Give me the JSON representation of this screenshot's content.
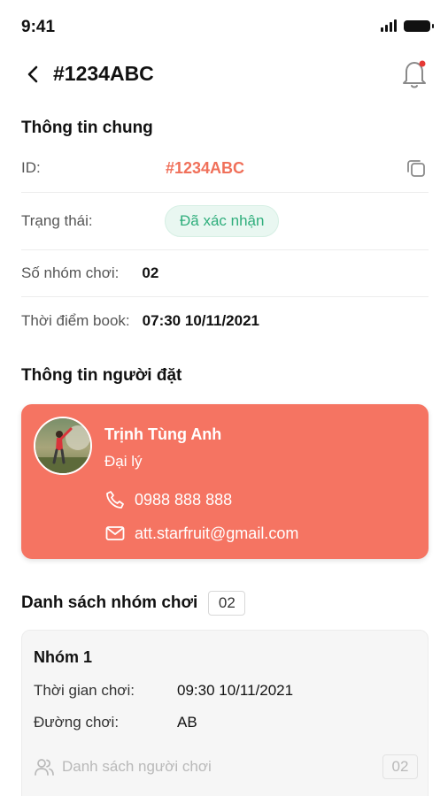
{
  "status_bar": {
    "time": "9:41"
  },
  "header": {
    "title": "#1234ABC",
    "back_icon": "chevron-left-icon",
    "bell_icon": "bell-icon"
  },
  "general": {
    "title": "Thông tin chung",
    "id_label": "ID:",
    "id_value": "#1234ABC",
    "status_label": "Trạng thái:",
    "status_value": "Đã xác nhận",
    "groups_count_label": "Số nhóm chơi:",
    "groups_count_value": "02",
    "booked_at_label": "Thời điểm book:",
    "booked_at_value": "07:30 10/11/2021"
  },
  "booker": {
    "title": "Thông tin người đặt",
    "name": "Trịnh Tùng Anh",
    "role": "Đại lý",
    "phone": "0988 888 888",
    "email": "att.starfruit@gmail.com"
  },
  "groups": {
    "title": "Danh sách nhóm chơi",
    "count": "02",
    "items": [
      {
        "name": "Nhóm 1",
        "time_label": "Thời gian chơi:",
        "time_value": "09:30 10/11/2021",
        "course_label": "Đường chơi:",
        "course_value": "AB",
        "players_label": "Danh sách người chơi",
        "players_count": "02"
      }
    ]
  },
  "colors": {
    "accent": "#f57462",
    "id_text": "#f0705a",
    "status_text": "#2fae7c",
    "status_bg": "#e9f7f1",
    "notification_dot": "#e53935"
  }
}
